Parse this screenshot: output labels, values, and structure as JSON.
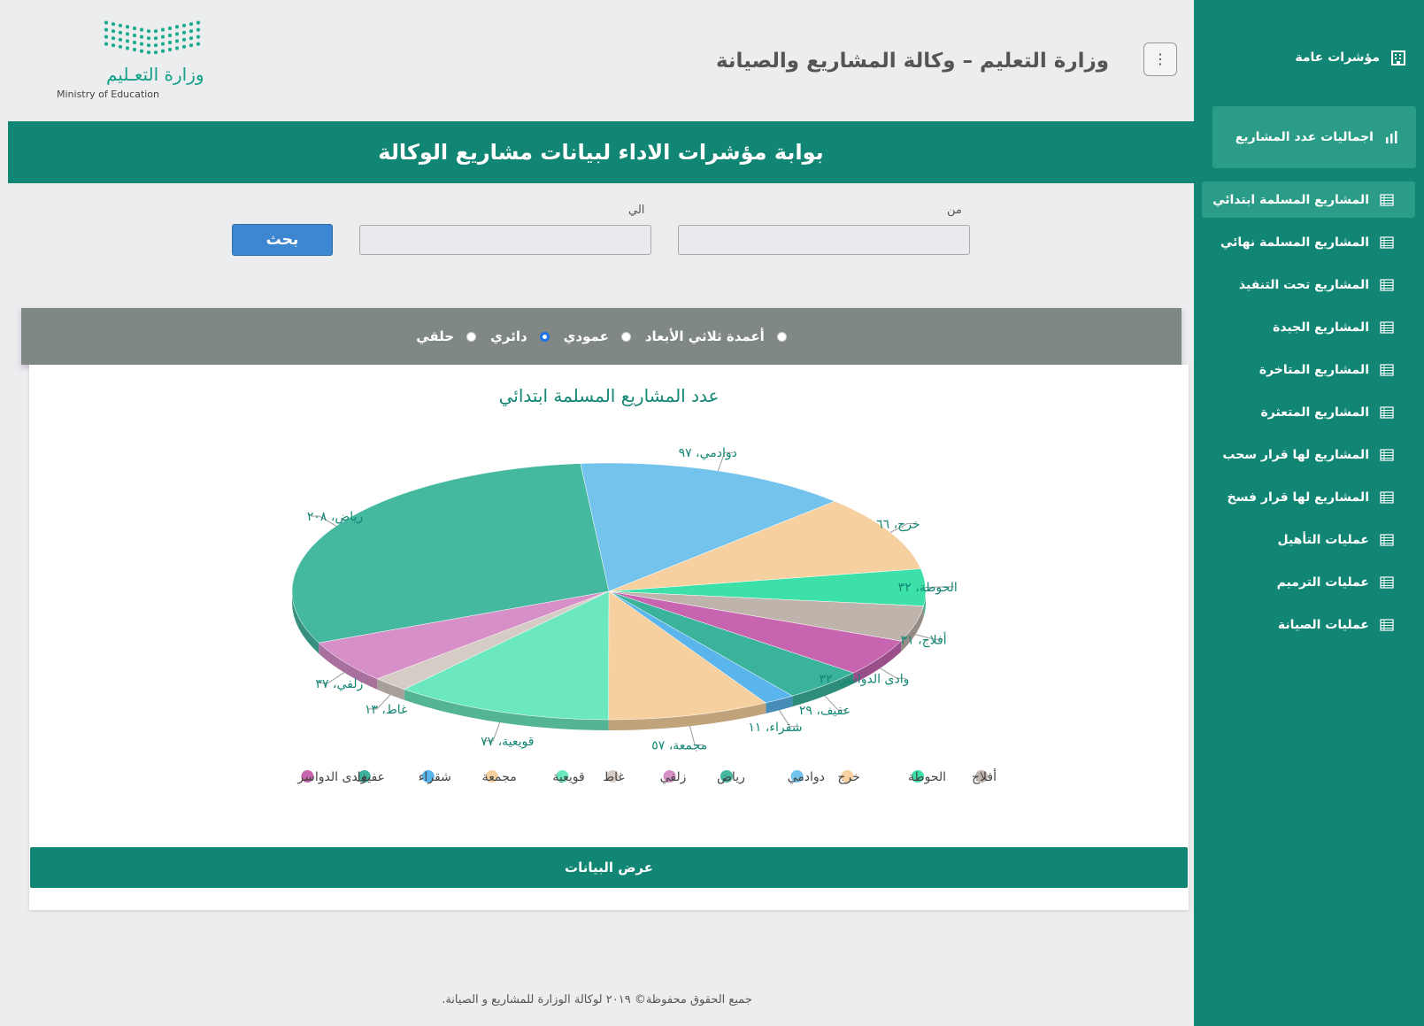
{
  "header": {
    "title": "وزارة التعليم – وكالة المشاريع والصيانة",
    "logo_ar": "وزارة التعـليم",
    "logo_en": "Ministry of Education",
    "menu_icon": "vertical-dots-icon"
  },
  "banner": {
    "title": "بوابة مؤشرات الاداء لبيانات مشاريع الوكالة"
  },
  "filters": {
    "from_label": "من",
    "to_label": "الي",
    "from_value": "",
    "to_value": "",
    "search_label": "بحث"
  },
  "chart_types": [
    {
      "label": "أعمدة ثلاثي الأبعاد",
      "selected": false
    },
    {
      "label": "عمودي",
      "selected": false
    },
    {
      "label": "دائري",
      "selected": true
    },
    {
      "label": "حلقي",
      "selected": false
    }
  ],
  "chart_data": {
    "type": "pie",
    "title": "عدد المشاريع المسلمة ابتدائي",
    "categories": [
      "دوادمي",
      "خرج",
      "الحوطة",
      "أفلاج",
      "وادى الدواسر",
      "عفيف",
      "شقراء",
      "مجمعة",
      "قويعية",
      "غاط",
      "زلفي",
      "رياض"
    ],
    "values": [
      97,
      66,
      32,
      31,
      32,
      29,
      11,
      57,
      77,
      13,
      37,
      208
    ],
    "value_labels": [
      "٩٧",
      "٦٦",
      "٣٢",
      "٣١",
      "٣٢",
      "٢٩",
      "١١",
      "٥٧",
      "٧٧",
      "١٣",
      "٣٧",
      "٢٠٨"
    ],
    "colors": [
      "#73c3ec",
      "#f6d09e",
      "#3de0a9",
      "#bfb4ac",
      "#c765b1",
      "#3bb39c",
      "#59b5eb",
      "#f6d09e",
      "#6be8c0",
      "#d6ccc6",
      "#d78fc8",
      "#45b8a0"
    ],
    "legend": [
      "أفلاج",
      "الحوطة",
      "خرج",
      "دوادمي",
      "رياض",
      "زلفي",
      "غاط",
      "قويعية",
      "مجمعة",
      "شقراء",
      "عفيف",
      "وادى الدواسر"
    ],
    "legend_colors": [
      "#bfb4ac",
      "#3de0a9",
      "#f6d09e",
      "#73c3ec",
      "#45b8a0",
      "#d78fc8",
      "#d6ccc6",
      "#6be8c0",
      "#f6d09e",
      "#59b5eb",
      "#3bb39c",
      "#c765b1"
    ],
    "legend_position": "bottom"
  },
  "view_data_label": "عرض البيانات",
  "footer": "جميع الحقوق محفوظة© ٢٠١٩ لوكالة الوزارة للمشاريع و الصيانة.",
  "sidebar": {
    "top_item": "مؤشرات عامة",
    "active_item": "اجماليات عدد المشاريع",
    "items": [
      "المشاريع المسلمة ابتدائي",
      "المشاريع المسلمة نهائي",
      "المشاريع تحت التنفيذ",
      "المشاريع الجيدة",
      "المشاريع المتاخرة",
      "المشاريع المتعثرة",
      "المشاريع لها قرار سحب",
      "المشاريع لها قرار فسخ",
      "عمليات التأهيل",
      "عمليات الترميم",
      "عمليات الصيانة"
    ]
  }
}
